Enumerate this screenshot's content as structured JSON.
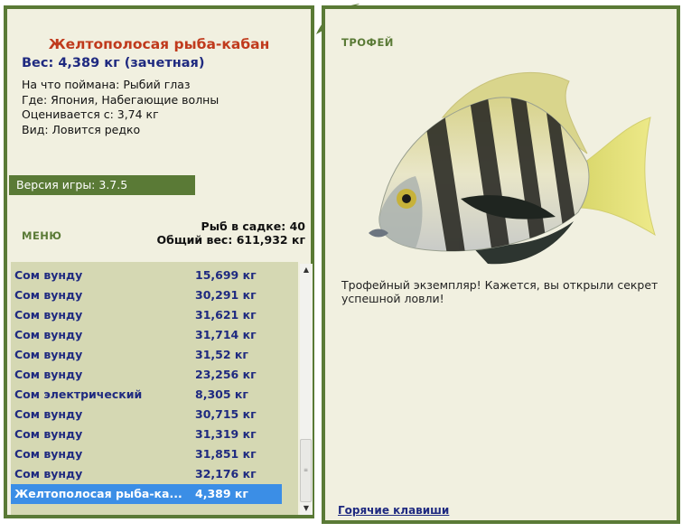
{
  "fish": {
    "title": "Желтополосая рыба-кабан",
    "weight_line": "Вес: 4,389 кг (зачетная)",
    "info": [
      "На что поймана: Рыбий глаз",
      "Где: Япония, Набегающие волны",
      "Оценивается с: 3,74 кг",
      "Вид: Ловится редко"
    ]
  },
  "version": "Версия игры: 3.7.5",
  "menu_label": "МЕНЮ",
  "stats": {
    "fish_in_cage": "Рыб в садке: 40",
    "total_weight": "Общий вес: 611,932 кг"
  },
  "list": [
    {
      "name": "Сом вунду",
      "weight": "15,699 кг"
    },
    {
      "name": "Сом вунду",
      "weight": "30,291 кг"
    },
    {
      "name": "Сом вунду",
      "weight": "31,621 кг"
    },
    {
      "name": "Сом вунду",
      "weight": "31,714 кг"
    },
    {
      "name": "Сом вунду",
      "weight": "31,52 кг"
    },
    {
      "name": "Сом вунду",
      "weight": "23,256 кг"
    },
    {
      "name": "Сом электрический",
      "weight": "8,305 кг"
    },
    {
      "name": "Сом вунду",
      "weight": "30,715 кг"
    },
    {
      "name": "Сом вунду",
      "weight": "31,319 кг"
    },
    {
      "name": "Сом вунду",
      "weight": "31,851 кг"
    },
    {
      "name": "Сом вунду",
      "weight": "32,176 кг"
    },
    {
      "name": "Желтополосая рыба-ка...",
      "weight": "4,389 кг",
      "selected": true
    }
  ],
  "trophy": {
    "label": "ТРОФЕЙ",
    "text": "Трофейный экземпляр! Кажется, вы открыли секрет успешной ловли!"
  },
  "hotkeys_label": "Горячие клавиши",
  "colors": {
    "panel_border": "#5a7a36",
    "panel_bg": "#f1f0e0",
    "list_bg": "#d5d8b3",
    "selection": "#3b8ee6",
    "title_red": "#c03a1c",
    "text_blue": "#1f2a80"
  }
}
